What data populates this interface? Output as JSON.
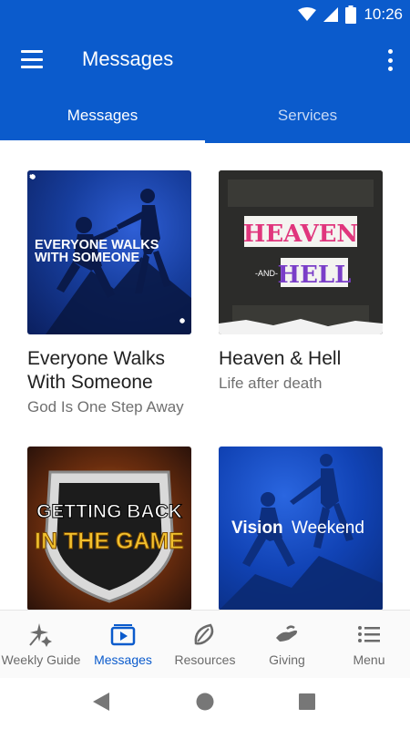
{
  "status_bar": {
    "time": "10:26"
  },
  "app_bar": {
    "title": "Messages"
  },
  "tabs": [
    {
      "label": "Messages",
      "active": true
    },
    {
      "label": "Services",
      "active": false
    }
  ],
  "cards": [
    {
      "title": "Everyone Walks With Someone",
      "subtitle": "God Is One Step Away",
      "art_text": [
        "EVERYONE WALKS",
        "WITH SOMEONE"
      ]
    },
    {
      "title": "Heaven & Hell",
      "subtitle": "Life after death",
      "art_text": [
        "HEAVEN",
        "-AND-",
        "HELL"
      ]
    },
    {
      "title": "",
      "subtitle": "",
      "art_text": [
        "GETTING BACK",
        "IN THE GAME"
      ]
    },
    {
      "title": "",
      "subtitle": "",
      "art_text": [
        "Vision",
        "Weekend"
      ]
    }
  ],
  "bottom_nav": [
    {
      "label": "Weekly Guide",
      "icon": "sparkle-icon",
      "active": false
    },
    {
      "label": "Messages",
      "icon": "play-icon",
      "active": true
    },
    {
      "label": "Resources",
      "icon": "leaf-icon",
      "active": false
    },
    {
      "label": "Giving",
      "icon": "giving-hand-icon",
      "active": false
    },
    {
      "label": "Menu",
      "icon": "menu-list-icon",
      "active": false
    }
  ],
  "colors": {
    "primary": "#0b5bcc",
    "inactive_nav": "#6b6b6b"
  }
}
